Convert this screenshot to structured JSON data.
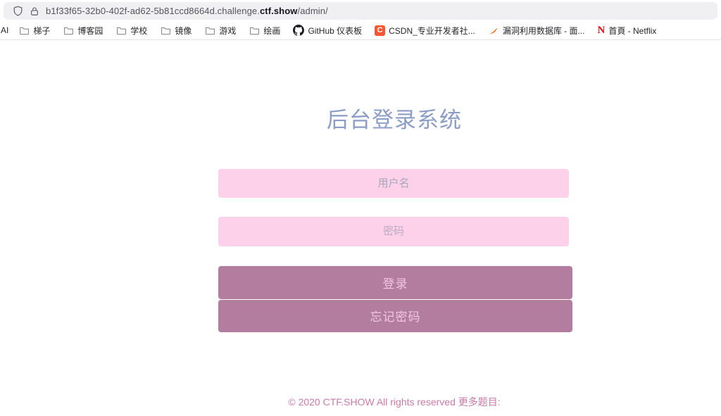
{
  "browser": {
    "url": {
      "prefix": "b1f33f65-32b0-402f-ad62-5b81ccd8664d.challenge.",
      "domain": "ctf.show",
      "path": "/admin/"
    },
    "bookmarks": [
      {
        "label": "AI",
        "icon": "none"
      },
      {
        "label": "梯子",
        "icon": "folder"
      },
      {
        "label": "博客园",
        "icon": "folder"
      },
      {
        "label": "学校",
        "icon": "folder"
      },
      {
        "label": "镜像",
        "icon": "folder"
      },
      {
        "label": "游戏",
        "icon": "folder"
      },
      {
        "label": "绘画",
        "icon": "folder"
      },
      {
        "label": "GitHub 仪表板",
        "icon": "github"
      },
      {
        "label": "CSDN_专业开发者社...",
        "icon": "csdn"
      },
      {
        "label": "漏洞利用数据库 - 面...",
        "icon": "exploit"
      },
      {
        "label": "首頁 - Netflix",
        "icon": "netflix"
      }
    ],
    "csdn_icon_letter": "C",
    "netflix_icon_letter": "N"
  },
  "login": {
    "title": "后台登录系统",
    "username_placeholder": "用户名",
    "password_placeholder": "密码",
    "login_button": "登录",
    "forgot_button": "忘记密码"
  },
  "footer": {
    "text": "© 2020 CTF.SHOW All rights reserved 更多题目:"
  },
  "colors": {
    "title": "#8b9cc6",
    "input_background": "#fcd1e9",
    "button_background": "#b37d9f",
    "button_text": "#f3c6e1",
    "footer_text": "#c87aa8",
    "csdn_brand": "#fc5531",
    "netflix_brand": "#e50914",
    "exploit_brand": "#e8701f",
    "urlbar_background": "#f0f0f2"
  }
}
